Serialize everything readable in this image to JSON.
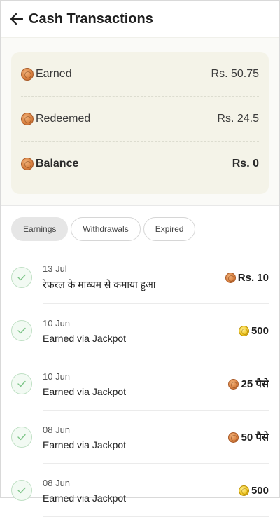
{
  "header": {
    "title": "Cash Transactions"
  },
  "summary": {
    "earned": {
      "label": "Earned",
      "value": "Rs. 50.75"
    },
    "redeemed": {
      "label": "Redeemed",
      "value": "Rs. 24.5"
    },
    "balance": {
      "label": "Balance",
      "value": "Rs. 0"
    }
  },
  "tabs": [
    {
      "label": "Earnings",
      "active": true
    },
    {
      "label": "Withdrawals",
      "active": false
    },
    {
      "label": "Expired",
      "active": false
    }
  ],
  "transactions": [
    {
      "date": "13 Jul",
      "desc": "रेफरल के माध्यम से कमाया हुआ",
      "amount": "Rs. 10",
      "coin": "copper"
    },
    {
      "date": "10 Jun",
      "desc": "Earned via Jackpot",
      "amount": "500",
      "coin": "gold"
    },
    {
      "date": "10 Jun",
      "desc": "Earned via Jackpot",
      "amount": "25 पैसे",
      "coin": "copper"
    },
    {
      "date": "08 Jun",
      "desc": "Earned via Jackpot",
      "amount": "50 पैसे",
      "coin": "copper"
    },
    {
      "date": "08 Jun",
      "desc": "Earned via Jackpot",
      "amount": "500",
      "coin": "gold"
    }
  ],
  "colors": {
    "card_bg": "#f4f3e8",
    "check_green": "#7cc487",
    "coin_copper": "#d9803f",
    "coin_gold": "#f2c923"
  }
}
